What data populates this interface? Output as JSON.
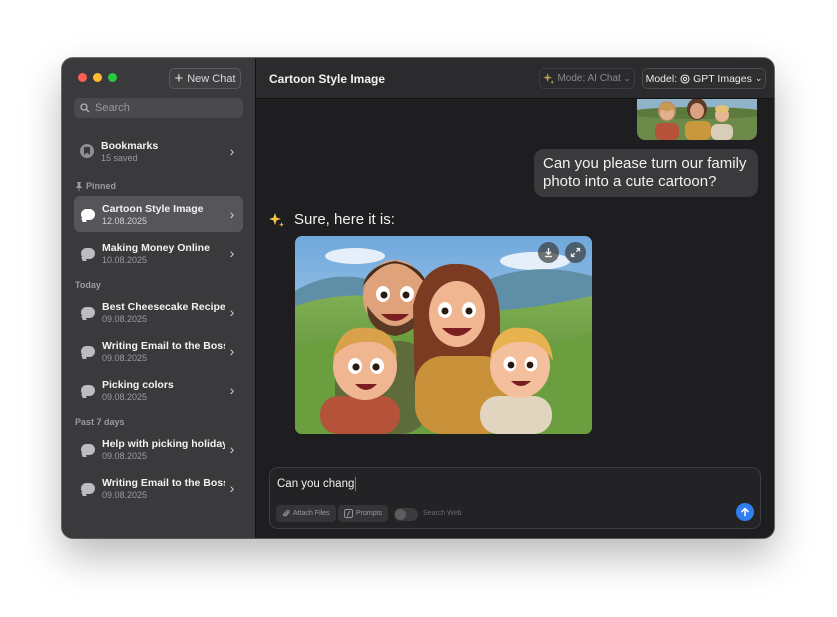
{
  "sidebar": {
    "new_chat_label": "New Chat",
    "search_placeholder": "Search",
    "bookmarks": {
      "title": "Bookmarks",
      "subtitle": "15 saved"
    },
    "sections": {
      "pinned": "Pinned",
      "today": "Today",
      "past7": "Past 7 days"
    },
    "pinned_items": [
      {
        "title": "Cartoon Style Image",
        "date": "12.08.2025",
        "active": true
      },
      {
        "title": "Making Money Online",
        "date": "10.08.2025"
      }
    ],
    "today_items": [
      {
        "title": "Best Cheesecake Recipe",
        "date": "09.08.2025"
      },
      {
        "title": "Writing Email to the Boss",
        "date": "09.08.2025"
      },
      {
        "title": "Picking colors",
        "date": "09.08.2025"
      }
    ],
    "past7_items": [
      {
        "title": "Help with picking holiday",
        "date": "09.08.2025"
      },
      {
        "title": "Writing Email to the Boss",
        "date": "09.08.2025"
      }
    ]
  },
  "header": {
    "title": "Cartoon Style Image",
    "mode_label": "Mode: AI Chat",
    "model_prefix": "Model:",
    "model_name": "GPT Images"
  },
  "conversation": {
    "user_message": "Can you please turn our family photo into a cute cartoon?",
    "assistant_message": "Sure, here it is:"
  },
  "composer": {
    "text": "Can you chang",
    "attach_label": "Attach Files",
    "prompts_label": "Prompts",
    "search_web_label": "Search Web",
    "search_web_enabled": false
  },
  "colors": {
    "accent": "#2f7ff1",
    "sidebar_bg": "#3a3a3c",
    "main_bg": "#1e1e20",
    "sparkle": "#f5c542"
  }
}
